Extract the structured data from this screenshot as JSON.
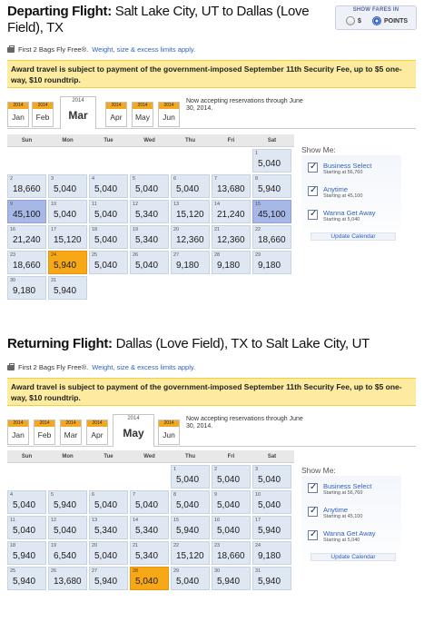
{
  "fare_toggle": {
    "label": "SHOW FARES IN",
    "dollars": "$",
    "points": "POINTS",
    "selected": "POINTS"
  },
  "departing": {
    "title_bold": "Departing Flight:",
    "title_route": "Salt Lake City, UT to Dallas (Love Field), TX",
    "bags_text": "First 2 Bags Fly Free®.",
    "bags_link": "Weight, size & excess limits apply.",
    "notice": "Award travel is subject to payment of the government-imposed September 11th Security Fee, up to $5 one-way, $10 roundtrip.",
    "months": [
      {
        "year": "2014",
        "month": "Jan"
      },
      {
        "year": "2014",
        "month": "Feb"
      },
      {
        "year": "2014",
        "month": "Mar",
        "active": true
      },
      {
        "year": "2014",
        "month": "Apr"
      },
      {
        "year": "2014",
        "month": "May"
      },
      {
        "year": "2014",
        "month": "Jun"
      }
    ],
    "reservation_note": "Now accepting reservations through June 30, 2014.",
    "weekdays": [
      "Sun",
      "Mon",
      "Tue",
      "Wed",
      "Thu",
      "Fri",
      "Sat"
    ],
    "days": [
      {
        "week": 0,
        "dow": 6,
        "day": "1",
        "price": "5,040"
      },
      {
        "week": 1,
        "dow": 0,
        "day": "2",
        "price": "18,660"
      },
      {
        "week": 1,
        "dow": 1,
        "day": "3",
        "price": "5,040"
      },
      {
        "week": 1,
        "dow": 2,
        "day": "4",
        "price": "5,040"
      },
      {
        "week": 1,
        "dow": 3,
        "day": "5",
        "price": "5,040"
      },
      {
        "week": 1,
        "dow": 4,
        "day": "6",
        "price": "5,040"
      },
      {
        "week": 1,
        "dow": 5,
        "day": "7",
        "price": "13,680"
      },
      {
        "week": 1,
        "dow": 6,
        "day": "8",
        "price": "5,940"
      },
      {
        "week": 2,
        "dow": 0,
        "day": "9",
        "price": "45,100",
        "style": "blue"
      },
      {
        "week": 2,
        "dow": 1,
        "day": "10",
        "price": "5,040"
      },
      {
        "week": 2,
        "dow": 2,
        "day": "11",
        "price": "5,040"
      },
      {
        "week": 2,
        "dow": 3,
        "day": "12",
        "price": "5,340"
      },
      {
        "week": 2,
        "dow": 4,
        "day": "13",
        "price": "15,120"
      },
      {
        "week": 2,
        "dow": 5,
        "day": "14",
        "price": "21,240"
      },
      {
        "week": 2,
        "dow": 6,
        "day": "15",
        "price": "45,100",
        "style": "blue"
      },
      {
        "week": 3,
        "dow": 0,
        "day": "16",
        "price": "21,240"
      },
      {
        "week": 3,
        "dow": 1,
        "day": "17",
        "price": "15,120"
      },
      {
        "week": 3,
        "dow": 2,
        "day": "18",
        "price": "5,040"
      },
      {
        "week": 3,
        "dow": 3,
        "day": "19",
        "price": "5,340"
      },
      {
        "week": 3,
        "dow": 4,
        "day": "20",
        "price": "12,360"
      },
      {
        "week": 3,
        "dow": 5,
        "day": "21",
        "price": "12,360"
      },
      {
        "week": 3,
        "dow": 6,
        "day": "22",
        "price": "18,660"
      },
      {
        "week": 4,
        "dow": 0,
        "day": "23",
        "price": "18,660"
      },
      {
        "week": 4,
        "dow": 1,
        "day": "24",
        "price": "5,940",
        "style": "sel"
      },
      {
        "week": 4,
        "dow": 2,
        "day": "25",
        "price": "5,040"
      },
      {
        "week": 4,
        "dow": 3,
        "day": "26",
        "price": "5,040"
      },
      {
        "week": 4,
        "dow": 4,
        "day": "27",
        "price": "9,180"
      },
      {
        "week": 4,
        "dow": 5,
        "day": "28",
        "price": "9,180"
      },
      {
        "week": 4,
        "dow": 6,
        "day": "29",
        "price": "9,180"
      },
      {
        "week": 5,
        "dow": 0,
        "day": "30",
        "price": "9,180"
      },
      {
        "week": 5,
        "dow": 1,
        "day": "31",
        "price": "5,940"
      }
    ],
    "show_me": {
      "title": "Show Me:",
      "options": [
        {
          "label": "Business Select",
          "sub": "Starting at 56,760"
        },
        {
          "label": "Anytime",
          "sub": "Starting at 45,100"
        },
        {
          "label": "Wanna Get Away",
          "sub": "Starting at 5,040"
        }
      ],
      "update": "Update Calendar"
    }
  },
  "returning": {
    "title_bold": "Returning Flight:",
    "title_route": "Dallas (Love Field), TX to Salt Lake City, UT",
    "bags_text": "First 2 Bags Fly Free®.",
    "bags_link": "Weight, size & excess limits apply.",
    "notice": "Award travel is subject to payment of the government-imposed September 11th Security Fee, up to $5 one-way, $10 roundtrip.",
    "months": [
      {
        "year": "2014",
        "month": "Jan"
      },
      {
        "year": "2014",
        "month": "Feb"
      },
      {
        "year": "2014",
        "month": "Mar"
      },
      {
        "year": "2014",
        "month": "Apr"
      },
      {
        "year": "2014",
        "month": "May",
        "active": true
      },
      {
        "year": "2014",
        "month": "Jun"
      }
    ],
    "reservation_note": "Now accepting reservations through June 30, 2014.",
    "weekdays": [
      "Sun",
      "Mon",
      "Tue",
      "Wed",
      "Thu",
      "Fri",
      "Sat"
    ],
    "days": [
      {
        "week": 0,
        "dow": 4,
        "day": "1",
        "price": "5,040"
      },
      {
        "week": 0,
        "dow": 5,
        "day": "2",
        "price": "5,040"
      },
      {
        "week": 0,
        "dow": 6,
        "day": "3",
        "price": "5,040"
      },
      {
        "week": 1,
        "dow": 0,
        "day": "4",
        "price": "5,040"
      },
      {
        "week": 1,
        "dow": 1,
        "day": "5",
        "price": "5,940"
      },
      {
        "week": 1,
        "dow": 2,
        "day": "6",
        "price": "5,040"
      },
      {
        "week": 1,
        "dow": 3,
        "day": "7",
        "price": "5,040"
      },
      {
        "week": 1,
        "dow": 4,
        "day": "8",
        "price": "5,040"
      },
      {
        "week": 1,
        "dow": 5,
        "day": "9",
        "price": "5,040"
      },
      {
        "week": 1,
        "dow": 6,
        "day": "10",
        "price": "5,040"
      },
      {
        "week": 2,
        "dow": 0,
        "day": "11",
        "price": "5,040"
      },
      {
        "week": 2,
        "dow": 1,
        "day": "12",
        "price": "5,040"
      },
      {
        "week": 2,
        "dow": 2,
        "day": "13",
        "price": "5,340"
      },
      {
        "week": 2,
        "dow": 3,
        "day": "14",
        "price": "5,340"
      },
      {
        "week": 2,
        "dow": 4,
        "day": "15",
        "price": "5,940"
      },
      {
        "week": 2,
        "dow": 5,
        "day": "16",
        "price": "5,040"
      },
      {
        "week": 2,
        "dow": 6,
        "day": "17",
        "price": "5,940"
      },
      {
        "week": 3,
        "dow": 0,
        "day": "18",
        "price": "5,940"
      },
      {
        "week": 3,
        "dow": 1,
        "day": "19",
        "price": "6,540"
      },
      {
        "week": 3,
        "dow": 2,
        "day": "20",
        "price": "5,040"
      },
      {
        "week": 3,
        "dow": 3,
        "day": "21",
        "price": "5,340"
      },
      {
        "week": 3,
        "dow": 4,
        "day": "22",
        "price": "15,120"
      },
      {
        "week": 3,
        "dow": 5,
        "day": "23",
        "price": "18,660"
      },
      {
        "week": 3,
        "dow": 6,
        "day": "24",
        "price": "9,180"
      },
      {
        "week": 4,
        "dow": 0,
        "day": "25",
        "price": "5,940"
      },
      {
        "week": 4,
        "dow": 1,
        "day": "26",
        "price": "13,680"
      },
      {
        "week": 4,
        "dow": 2,
        "day": "27",
        "price": "5,940"
      },
      {
        "week": 4,
        "dow": 3,
        "day": "28",
        "price": "5,040",
        "style": "sel"
      },
      {
        "week": 4,
        "dow": 4,
        "day": "29",
        "price": "5,040"
      },
      {
        "week": 4,
        "dow": 5,
        "day": "30",
        "price": "5,940"
      },
      {
        "week": 4,
        "dow": 6,
        "day": "31",
        "price": "5,940"
      }
    ],
    "show_me": {
      "title": "Show Me:",
      "options": [
        {
          "label": "Business Select",
          "sub": "Starting at 56,760"
        },
        {
          "label": "Anytime",
          "sub": "Starting at 45,100"
        },
        {
          "label": "Wanna Get Away",
          "sub": "Starting at 5,040"
        }
      ],
      "update": "Update Calendar"
    }
  }
}
